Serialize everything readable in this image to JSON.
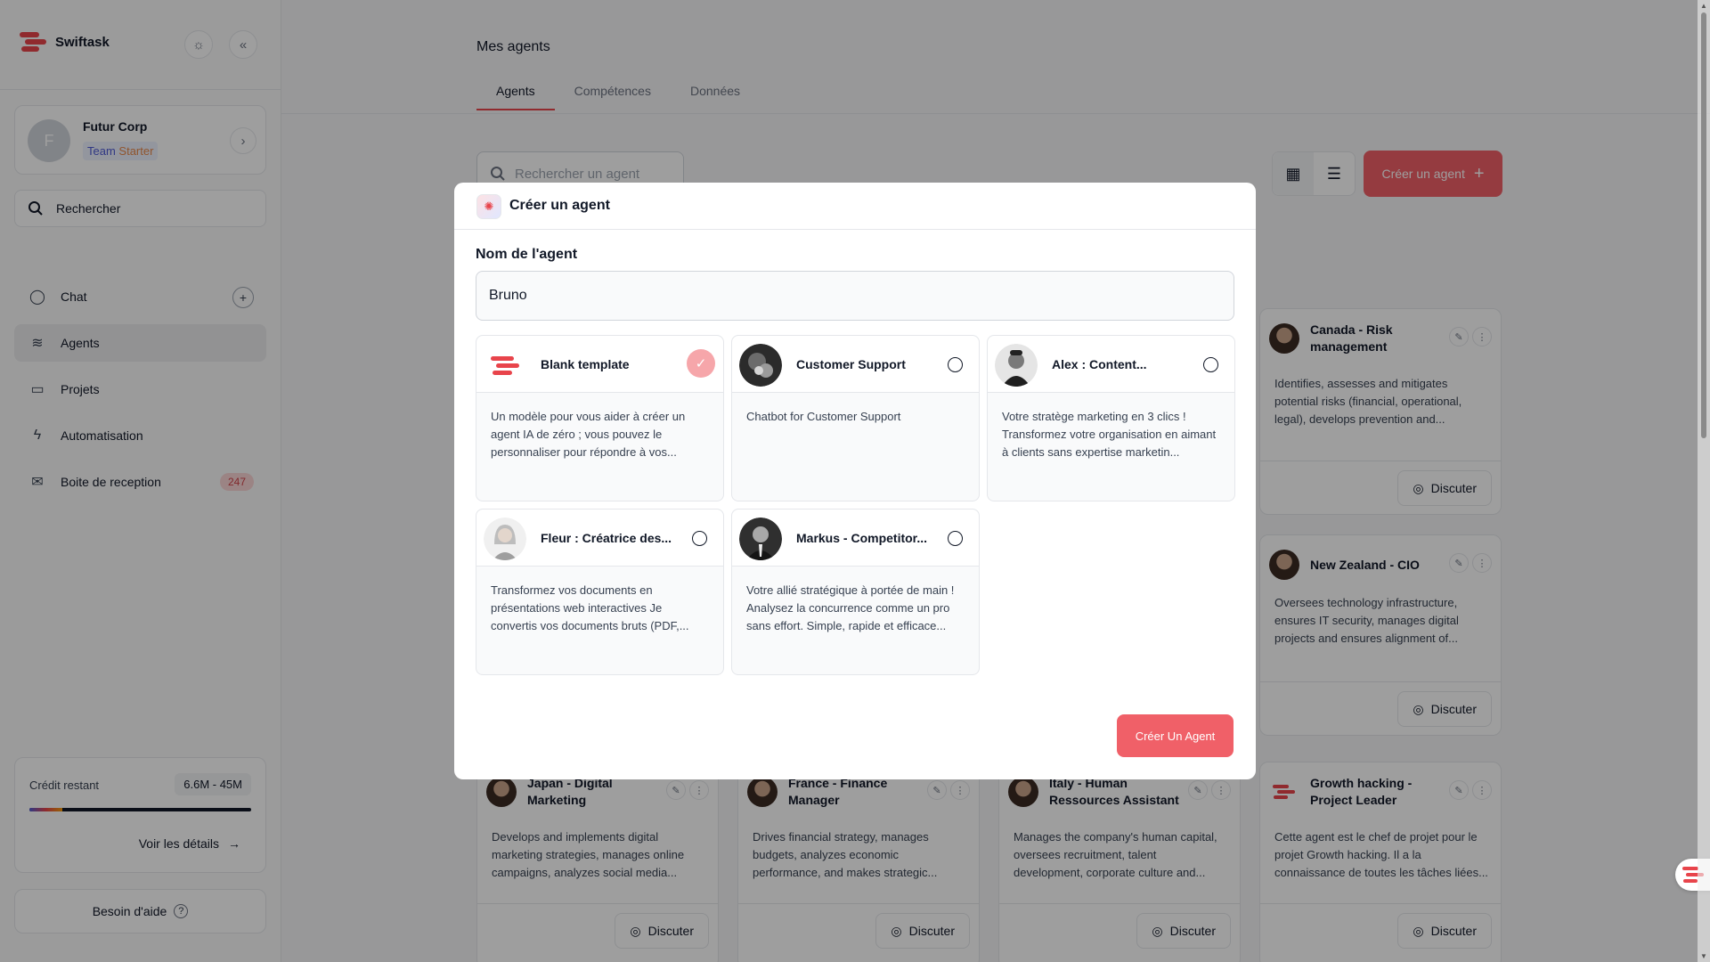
{
  "app": {
    "name": "Swiftask"
  },
  "org": {
    "name": "Futur Corp",
    "initial": "F",
    "plan_word": "Team",
    "plan_tier": "Starter"
  },
  "sidebar": {
    "search_label": "Rechercher",
    "items": [
      {
        "label": "Chat"
      },
      {
        "label": "Agents"
      },
      {
        "label": "Projets"
      },
      {
        "label": "Automatisation"
      },
      {
        "label": "Boite de reception",
        "badge": "247"
      }
    ],
    "credit": {
      "label": "Crédit restant",
      "value": "6.6M - 45M",
      "used_fraction": 0.15,
      "link": "Voir les détails"
    },
    "help": "Besoin d'aide",
    "help_glyph": "?"
  },
  "main": {
    "title": "Mes agents",
    "tabs": [
      {
        "label": "Agents"
      },
      {
        "label": "Compétences"
      },
      {
        "label": "Données"
      }
    ],
    "search_placeholder": "Rechercher un agent",
    "create_button": "Créer un agent",
    "discuss_label": "Discuter",
    "cards": [
      {
        "name": "Canada - Risk management",
        "desc": "Identifies, assesses and mitigates potential risks (financial, operational, legal), develops prevention and..."
      },
      {
        "name": "New Zealand - CIO",
        "desc": "Oversees technology infrastructure, ensures IT security, manages digital projects and ensures alignment of..."
      },
      {
        "name": "Japan - Digital Marketing",
        "desc": "Develops and implements digital marketing strategies, manages online campaigns, analyzes social media..."
      },
      {
        "name": "France - Finance Manager",
        "desc": "Drives financial strategy, manages budgets, analyzes economic performance, and makes strategic..."
      },
      {
        "name": "Italy - Human Ressources Assistant",
        "desc": "Manages the company's human capital, oversees recruitment, talent development, corporate culture and..."
      },
      {
        "name": "Growth hacking - Project Leader",
        "desc": "Cette agent est le chef de projet pour le projet Growth hacking. Il a la connaissance de toutes les tâches liées..."
      }
    ]
  },
  "modal": {
    "title": "Créer un agent",
    "field_label": "Nom de l'agent",
    "name_value": "Bruno",
    "submit": "Créer Un Agent",
    "templates": [
      {
        "name": "Blank template",
        "desc": "Un modèle pour vous aider à créer un agent IA de zéro ; vous pouvez le personnaliser pour répondre à vos...",
        "selected": true
      },
      {
        "name": "Customer Support",
        "desc": "Chatbot for Customer Support",
        "selected": false
      },
      {
        "name": "Alex : Content...",
        "desc": "Votre stratège marketing en 3 clics ! Transformez votre organisation en aimant à clients sans expertise marketin...",
        "selected": false
      },
      {
        "name": "Fleur : Créatrice des...",
        "desc": "Transformez vos documents en présentations web interactives Je convertis vos documents bruts (PDF,...",
        "selected": false
      },
      {
        "name": "Markus - Competitor...",
        "desc": "Votre allié stratégique à portée de main ! Analysez la concurrence comme un pro sans effort. Simple, rapide et efficace...",
        "selected": false
      }
    ]
  },
  "colors": {
    "accent": "#f06068",
    "brand": "#e8444b"
  }
}
